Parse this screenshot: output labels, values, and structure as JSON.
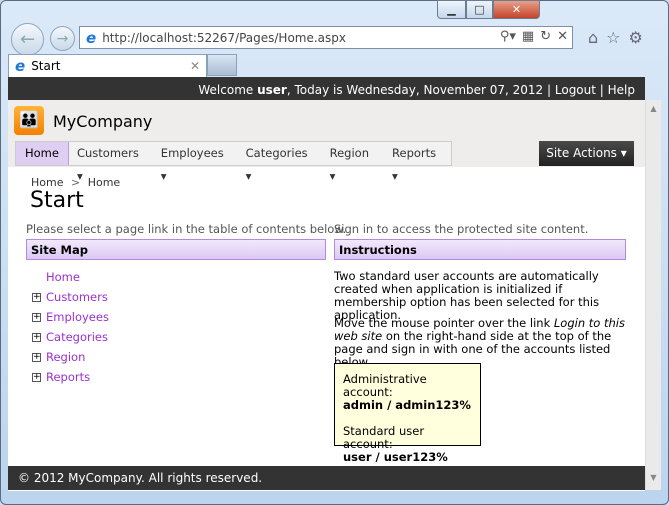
{
  "browser": {
    "url": "http://localhost:52267/Pages/Home.aspx",
    "tab_title": "Start"
  },
  "topbar": {
    "welcome": "Welcome ",
    "user": "user",
    "date_text": ", Today is Wednesday, November 07, 2012",
    "sep": " | ",
    "logout": "Logout",
    "help": "Help"
  },
  "brand": {
    "name": "MyCompany"
  },
  "menu": {
    "items": [
      {
        "label": "Home"
      },
      {
        "label": "Customers ▾"
      },
      {
        "label": "Employees ▾"
      },
      {
        "label": "Categories ▾"
      },
      {
        "label": "Region ▾"
      },
      {
        "label": "Reports ▾"
      }
    ],
    "site_actions": "Site Actions ▾"
  },
  "breadcrumb": {
    "items": [
      "Home",
      "Home"
    ],
    "sep": ">"
  },
  "page": {
    "title": "Start"
  },
  "left": {
    "desc": "Please select a page link in the table of contents below.",
    "header": "Site Map",
    "items": [
      "Home",
      "Customers",
      "Employees",
      "Categories",
      "Region",
      "Reports"
    ]
  },
  "right": {
    "desc": "Sign in to access the protected site content.",
    "header": "Instructions",
    "p1": "Two standard user accounts are automatically created when application is initialized if membership option has been selected for this application.",
    "p2_a": "Move the mouse pointer over the link ",
    "p2_em": "Login to this web site",
    "p2_b": " on the right-hand side at the top of the page and sign in with one of the accounts listed below.",
    "admin_label": "Administrative account:",
    "admin_cred": "admin / admin123%",
    "user_label": "Standard user account:",
    "user_cred": "user / user123%"
  },
  "footer": {
    "text": "© 2012 MyCompany. All rights reserved."
  }
}
